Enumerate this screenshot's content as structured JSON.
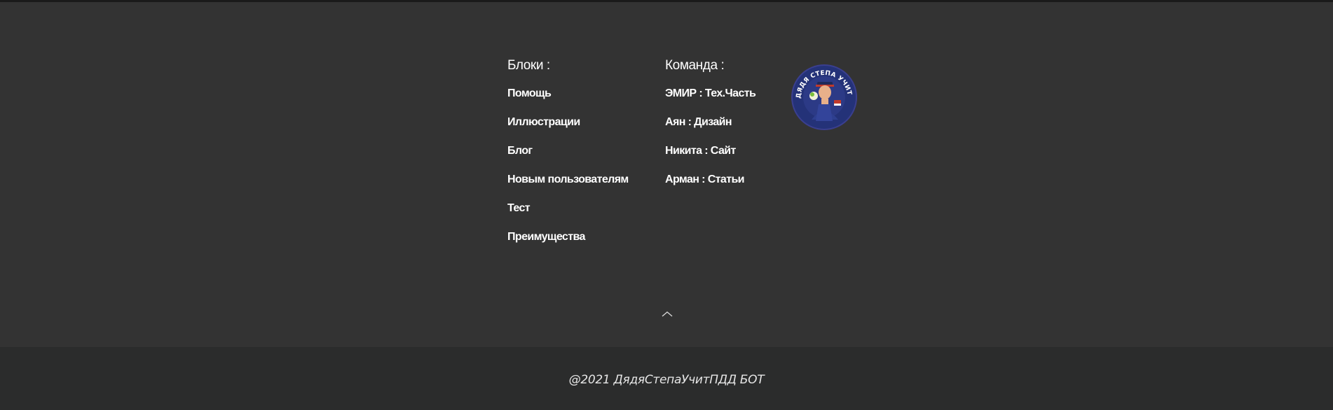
{
  "blocks": {
    "heading": "Блоки :",
    "items": [
      "Помощь",
      "Иллюстрации",
      "Блог",
      "Новым пользователям",
      "Тест",
      "Преимущества"
    ]
  },
  "team": {
    "heading": "Команда :",
    "items": [
      "ЭМИР : Тех.Часть",
      "Аян : Дизайн",
      "Никита : Сайт",
      "Арман : Статьи"
    ]
  },
  "logo": {
    "ring_text": "ДЯДЯ СТЕПА УЧИТ ПДД",
    "ring_color": "#2b3a8c"
  },
  "back_to_top_icon": "chevron-up-icon",
  "copyright": "@2021 ДядяСтепаУчитПДД БОТ",
  "colors": {
    "main_bg": "#333333",
    "bottom_bg": "#2b2c2c",
    "text": "#ffffff"
  }
}
